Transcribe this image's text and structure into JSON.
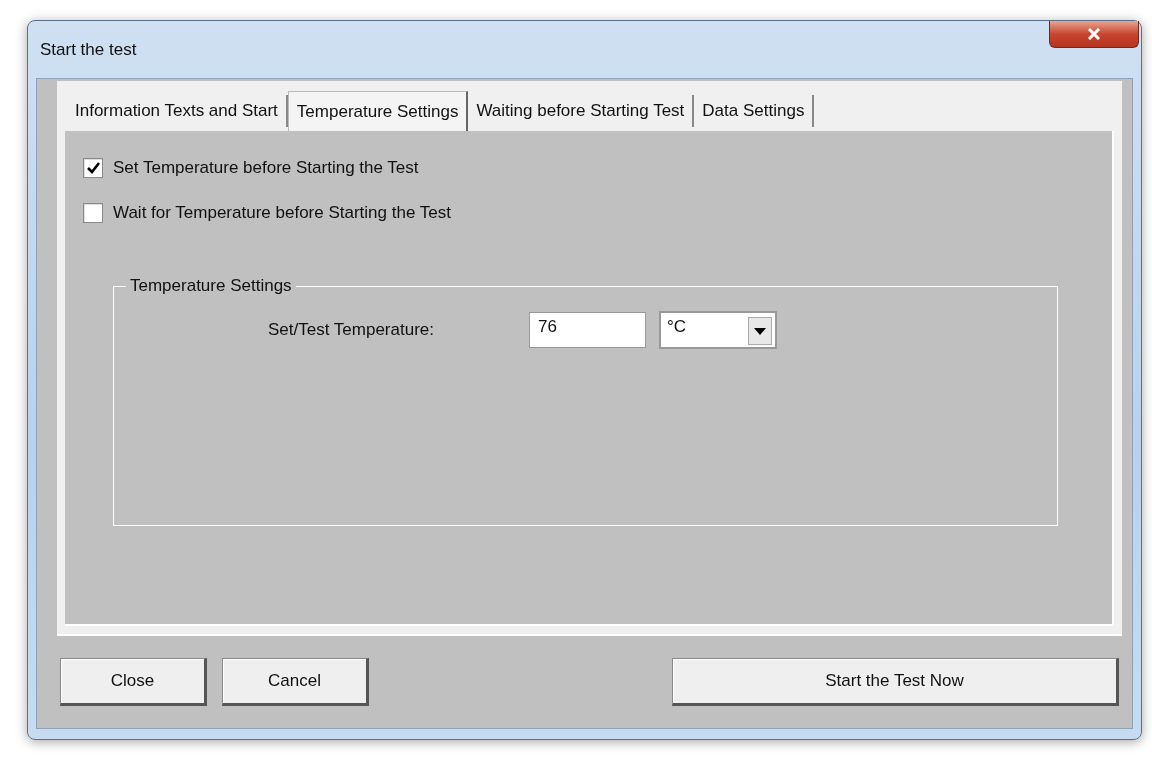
{
  "window": {
    "title": "Start the test"
  },
  "tabs": [
    {
      "label": "Information Texts and Start",
      "selected": false
    },
    {
      "label": "Temperature Settings",
      "selected": true
    },
    {
      "label": "Waiting before Starting Test",
      "selected": false
    },
    {
      "label": "Data Settings",
      "selected": false
    }
  ],
  "options": [
    {
      "label": "Set Temperature before Starting the Test",
      "checked": true
    },
    {
      "label": "Wait for Temperature before Starting the Test",
      "checked": false
    }
  ],
  "group": {
    "title": "Temperature Settings",
    "field_label": "Set/Test Temperature:",
    "value": "76",
    "unit": "°C"
  },
  "buttons": [
    {
      "label": "Close",
      "kind": "small"
    },
    {
      "label": "Cancel",
      "kind": "small"
    },
    {
      "label": "Start the Test Now",
      "kind": "wide"
    }
  ]
}
